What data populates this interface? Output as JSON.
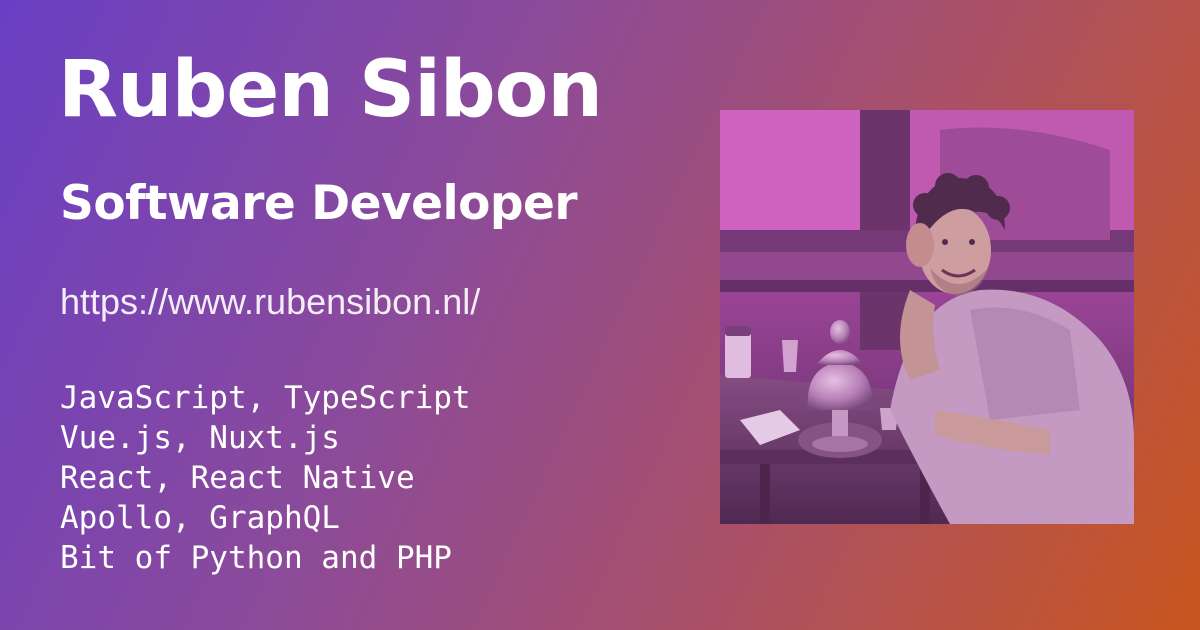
{
  "profile": {
    "name": "Ruben Sibon",
    "role": "Software Developer",
    "url": "https://www.rubensibon.nl/"
  },
  "skills": [
    "JavaScript, TypeScript",
    "Vue.js, Nuxt.js",
    "React, React Native",
    "Apollo, GraphQL",
    "Bit of Python and PHP"
  ],
  "photo": {
    "icon": "profile-photo"
  },
  "colors": {
    "gradient_start": "#6a3fc4",
    "gradient_end": "#c9561f",
    "photo_tint": "#b25ab8",
    "text": "#ffffff"
  }
}
